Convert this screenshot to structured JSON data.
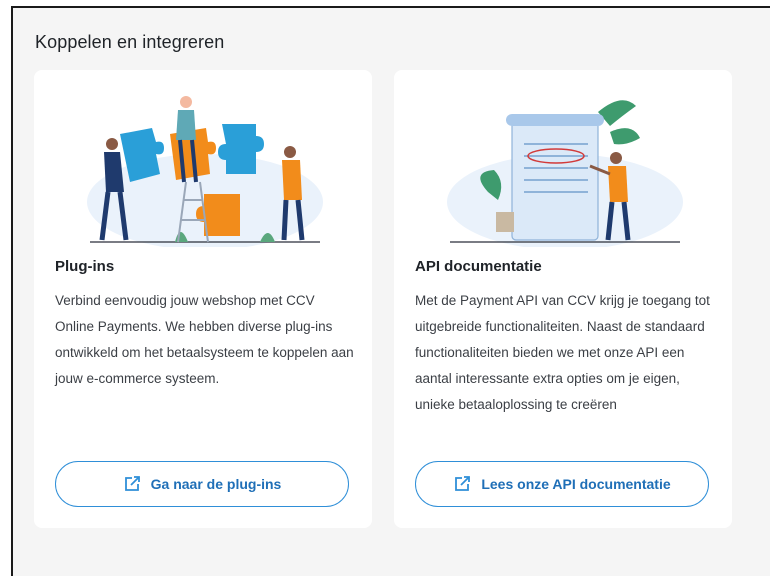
{
  "section": {
    "title": "Koppelen en integreren"
  },
  "cards": [
    {
      "title": "Plug-ins",
      "description": "Verbind eenvoudig jouw webshop met CCV Online Payments. We hebben diverse plug-ins ontwikkeld om het betaalsysteem te koppelen aan jouw e-commerce systeem.",
      "button_label": "Ga naar de plug-ins",
      "button_icon": "external-link-icon"
    },
    {
      "title": "API documentatie",
      "description": "Met de Payment API van CCV krijg je toegang tot uitgebreide functionaliteiten. Naast de standaard functionaliteiten bieden we met onze API een aantal interessante extra opties om je eigen, unieke betaaloplossing te creëren",
      "button_label": "Lees onze API documentatie",
      "button_icon": "external-link-icon"
    }
  ],
  "colors": {
    "accent": "#2f8fd8",
    "accent_text": "#1f6fb7",
    "orange": "#f28c1b",
    "blue": "#2a9fd8",
    "navy": "#1f3a6d",
    "green": "#3e9b6e",
    "panel_bg": "#f5f5f5"
  }
}
